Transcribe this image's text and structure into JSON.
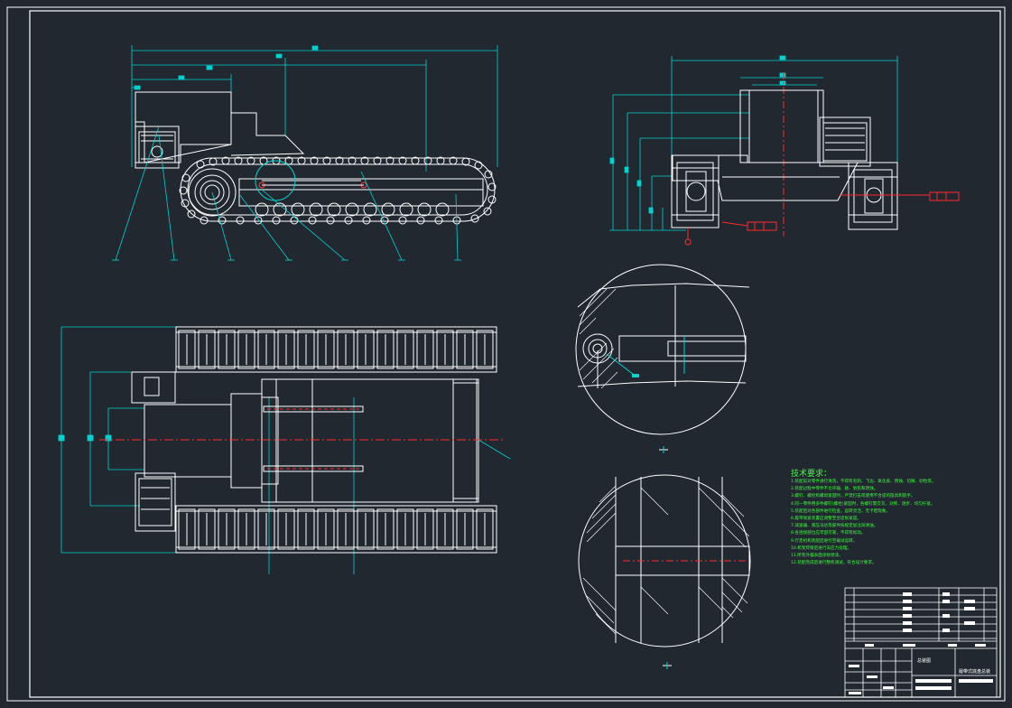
{
  "drawing": {
    "background": "#212830",
    "colors": {
      "frame": "#ffffff",
      "outline": "#ffffff",
      "dimension": "#00d2d2",
      "centerline": "#ff2a2a",
      "notes": "#3cff3c",
      "highlight": "#00e5e5"
    }
  },
  "notes": {
    "title": "技术要求：",
    "items": [
      "1.装配前对零件进行清洗，不得有毛刺、飞边、氧化皮、锈蚀、切屑、砂粒等。",
      "2.装配过程中零件不允许磕、碰、划伤和锈蚀。",
      "3.螺钉、螺栓和螺母紧固时，严禁打击或使用不合适的旋具和扳手。",
      "4.同一零件用多件螺钉(螺栓)紧固时，各螺钉需交叉、对称、逐步、均匀拧紧。",
      "5.装配后对各部件进行检查，运转灵活，无卡阻现象。",
      "6.履带张紧装置应调整至合适张紧度。",
      "7.减速器、液压马达等部件按规定加注润滑油。",
      "8.各连接部位应牢固可靠，不得有松动。",
      "9.行走机构装配后进行空载试运转。",
      "10.机架焊接后进行去应力处理。",
      "11.所有外露表面涂防锈漆。",
      "12.装配完成后进行整机调试，符合设计要求。"
    ]
  },
  "title_block": {
    "name": "总装图",
    "drawing_no": "履带式底盘总装"
  }
}
